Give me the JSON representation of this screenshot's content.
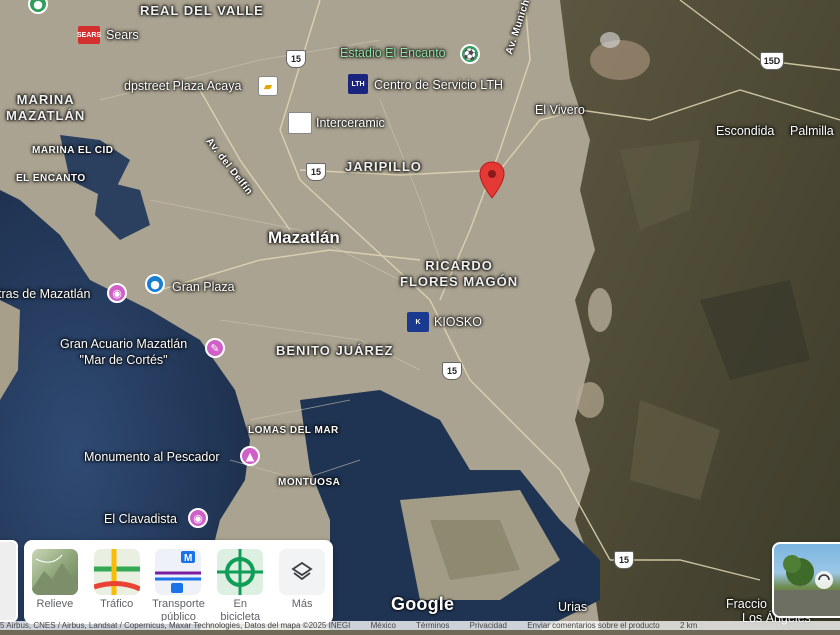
{
  "map": {
    "neighborhoods": {
      "real_del_valle": "REAL DEL VALLE",
      "marina_mazatlan": "MARINA\nMAZATLÁN",
      "marina_el_cid": "MARINA EL CID",
      "el_encanto": "EL ENCANTO",
      "jaripillo": "JARIPILLO",
      "ricardo_flores_magon": "RICARDO\nFLORES MAGÓN",
      "benito_juarez": "BENITO JUÁREZ",
      "lomas_del_mar": "LOMAS DEL MAR",
      "montuosa": "MONTUOSA"
    },
    "city": "Mazatlán",
    "places": {
      "sears": "Sears",
      "estadio": "Estadio El Encanto",
      "dpstreet": "dpstreet Plaza Acaya",
      "centro_servicio": "Centro de Servicio LTH",
      "interceramic": "Interceramic",
      "el_vivero": "El Vivero",
      "escondida": "Escondida",
      "palmilla": "Palmilla",
      "plaza_mazatlan": "tras de Mazatlán",
      "gran_plaza": "Gran Plaza",
      "acuario": "Gran Acuario Mazatlán\n\"Mar de Cortés\"",
      "kiosko": "KIOSKO",
      "monumento": "Monumento al Pescador",
      "clavadista": "El Clavadista",
      "urias": "Urias",
      "fraccio": "Fraccio",
      "los_angeles": "Los Ángeles",
      "av_munich": "Av. Munich",
      "av_del_delfin": "Av. del Delfín"
    },
    "highway_shields": [
      "15",
      "15",
      "15",
      "15",
      "15D"
    ]
  },
  "layers": [
    {
      "label": "Relieve",
      "icon": "terrain-icon"
    },
    {
      "label": "Tráfico",
      "icon": "traffic-icon"
    },
    {
      "label": "Transporte\npúblico",
      "icon": "transit-icon"
    },
    {
      "label": "En\nbicicleta",
      "icon": "bike-icon"
    },
    {
      "label": "Más",
      "icon": "layers-icon"
    }
  ],
  "google_logo": "Google",
  "attribution": {
    "data": "5 Airbus, CNES / Airbus, Landsat / Copernicus, Maxar Technologies, Datos del mapa ©2025 INEGI",
    "country": "México",
    "terms": "Términos",
    "privacy": "Privacidad",
    "feedback": "Enviar comentarios sobre el producto",
    "scale": "2 km"
  },
  "colors": {
    "pin_red": "#e53935",
    "poi_pink": "#d05fc8",
    "poi_blue": "#1a7fd3",
    "poi_green": "#2e9e5a",
    "water": "#24395a",
    "urban": "#b3ab9a",
    "mountain": "#4b4a35"
  }
}
